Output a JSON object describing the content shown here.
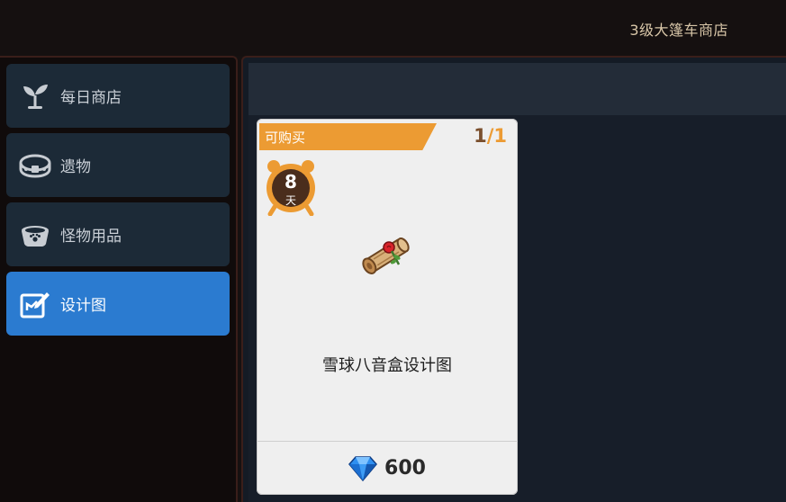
{
  "header": {
    "shop_title": "3级大篷车商店"
  },
  "sidebar": {
    "items": [
      {
        "label": "每日商店",
        "icon": "sprout-icon",
        "active": false
      },
      {
        "label": "遗物",
        "icon": "relic-ring-icon",
        "active": false
      },
      {
        "label": "怪物用品",
        "icon": "pet-bowl-icon",
        "active": false
      },
      {
        "label": "设计图",
        "icon": "blueprint-icon",
        "active": true
      }
    ]
  },
  "card": {
    "availability": "可购买",
    "stock_current": "1",
    "stock_separator": "/",
    "stock_max": "1",
    "timer_value": "8",
    "timer_unit": "天",
    "item_name": "雪球八音盒设计图",
    "item_icon": "scroll-rose-icon",
    "price": "600",
    "currency_icon": "diamond-icon"
  },
  "colors": {
    "accent_orange": "#ec9b33",
    "active_blue": "#2b7bd0",
    "sidebar_item": "#1c2a37",
    "gem_blue": "#2f8ff0"
  }
}
